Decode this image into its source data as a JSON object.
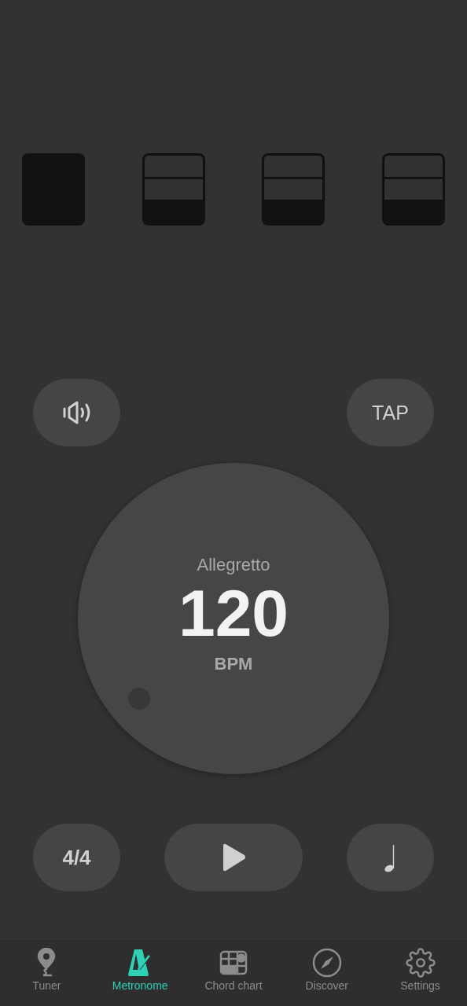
{
  "beats": [
    {
      "accent": true
    },
    {
      "accent": false
    },
    {
      "accent": false
    },
    {
      "accent": false
    }
  ],
  "controls": {
    "tap": "TAP"
  },
  "dial": {
    "tempo_name": "Allegretto",
    "bpm": "120",
    "unit": "BPM"
  },
  "bottom_controls": {
    "time_signature": "4/4"
  },
  "tabs": [
    {
      "label": "Tuner",
      "selected": false
    },
    {
      "label": "Metronome",
      "selected": true
    },
    {
      "label": "Chord chart",
      "selected": false
    },
    {
      "label": "Discover",
      "selected": false
    },
    {
      "label": "Settings",
      "selected": false
    }
  ]
}
